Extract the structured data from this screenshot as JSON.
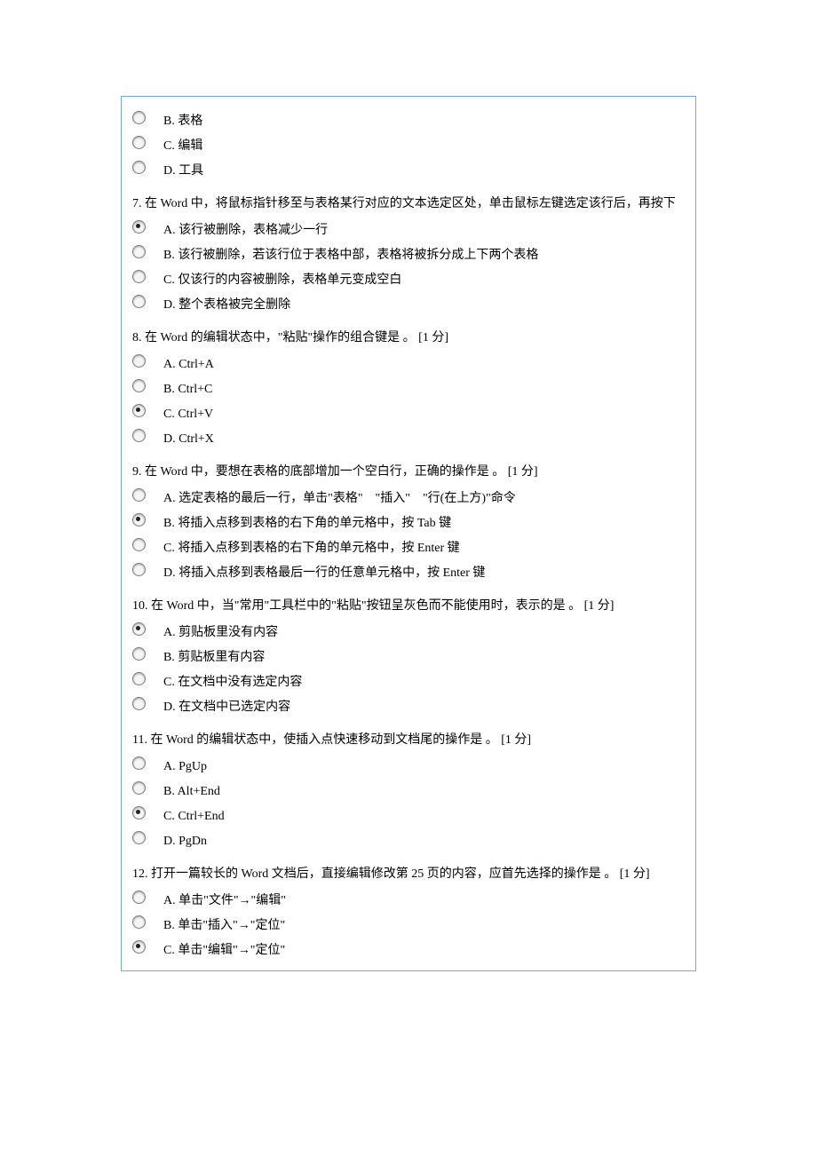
{
  "partial_options": [
    {
      "letter": "B",
      "text": "表格",
      "selected": false
    },
    {
      "letter": "C",
      "text": "编辑",
      "selected": false
    },
    {
      "letter": "D",
      "text": "工具",
      "selected": false
    }
  ],
  "questions": [
    {
      "num": "7",
      "text": "在 Word 中，将鼠标指针移至与表格某行对应的文本选定区处，单击鼠标左键选定该行后，再按下",
      "options": [
        {
          "letter": "A",
          "text": "该行被删除，表格减少一行",
          "selected": true
        },
        {
          "letter": "B",
          "text": "该行被删除，若该行位于表格中部，表格将被拆分成上下两个表格",
          "selected": false
        },
        {
          "letter": "C",
          "text": "仅该行的内容被删除，表格单元变成空白",
          "selected": false
        },
        {
          "letter": "D",
          "text": "整个表格被完全删除",
          "selected": false
        }
      ]
    },
    {
      "num": "8",
      "text": "在 Word 的编辑状态中，\"粘贴\"操作的组合键是 。 [1 分]",
      "options": [
        {
          "letter": "A",
          "text": "Ctrl+A",
          "selected": false
        },
        {
          "letter": "B",
          "text": "Ctrl+C",
          "selected": false
        },
        {
          "letter": "C",
          "text": "Ctrl+V",
          "selected": true
        },
        {
          "letter": "D",
          "text": "Ctrl+X",
          "selected": false
        }
      ]
    },
    {
      "num": "9",
      "text": "在 Word 中，要想在表格的底部增加一个空白行，正确的操作是 。 [1 分]",
      "options": [
        {
          "letter": "A",
          "text": "选定表格的最后一行，单击\"表格\"　\"插入\"　\"行(在上方)\"命令",
          "selected": false
        },
        {
          "letter": "B",
          "text": "将插入点移到表格的右下角的单元格中，按 Tab 键",
          "selected": true
        },
        {
          "letter": "C",
          "text": "将插入点移到表格的右下角的单元格中，按 Enter 键",
          "selected": false
        },
        {
          "letter": "D",
          "text": "将插入点移到表格最后一行的任意单元格中，按 Enter 键",
          "selected": false
        }
      ]
    },
    {
      "num": "10",
      "text": "在 Word 中，当\"常用\"工具栏中的\"粘贴\"按钮呈灰色而不能使用时，表示的是 。 [1 分]",
      "options": [
        {
          "letter": "A",
          "text": "剪贴板里没有内容",
          "selected": true
        },
        {
          "letter": "B",
          "text": "剪贴板里有内容",
          "selected": false
        },
        {
          "letter": "C",
          "text": "在文档中没有选定内容",
          "selected": false
        },
        {
          "letter": "D",
          "text": "在文档中已选定内容",
          "selected": false
        }
      ]
    },
    {
      "num": "11",
      "text": "在 Word 的编辑状态中，使插入点快速移动到文档尾的操作是 。 [1 分]",
      "options": [
        {
          "letter": "A",
          "text": "PgUp",
          "selected": false
        },
        {
          "letter": "B",
          "text": "Alt+End",
          "selected": false
        },
        {
          "letter": "C",
          "text": "Ctrl+End",
          "selected": true
        },
        {
          "letter": "D",
          "text": "PgDn",
          "selected": false
        }
      ]
    },
    {
      "num": "12",
      "text": "打开一篇较长的 Word 文档后，直接编辑修改第 25 页的内容，应首先选择的操作是 。 [1 分]",
      "options": [
        {
          "letter": "A",
          "text": "单击\"文件\"→\"编辑\"",
          "selected": false
        },
        {
          "letter": "B",
          "text": "单击\"插入\"→\"定位\"",
          "selected": false
        },
        {
          "letter": "C",
          "text": "单击\"编辑\"→\"定位\"",
          "selected": true
        }
      ]
    }
  ]
}
